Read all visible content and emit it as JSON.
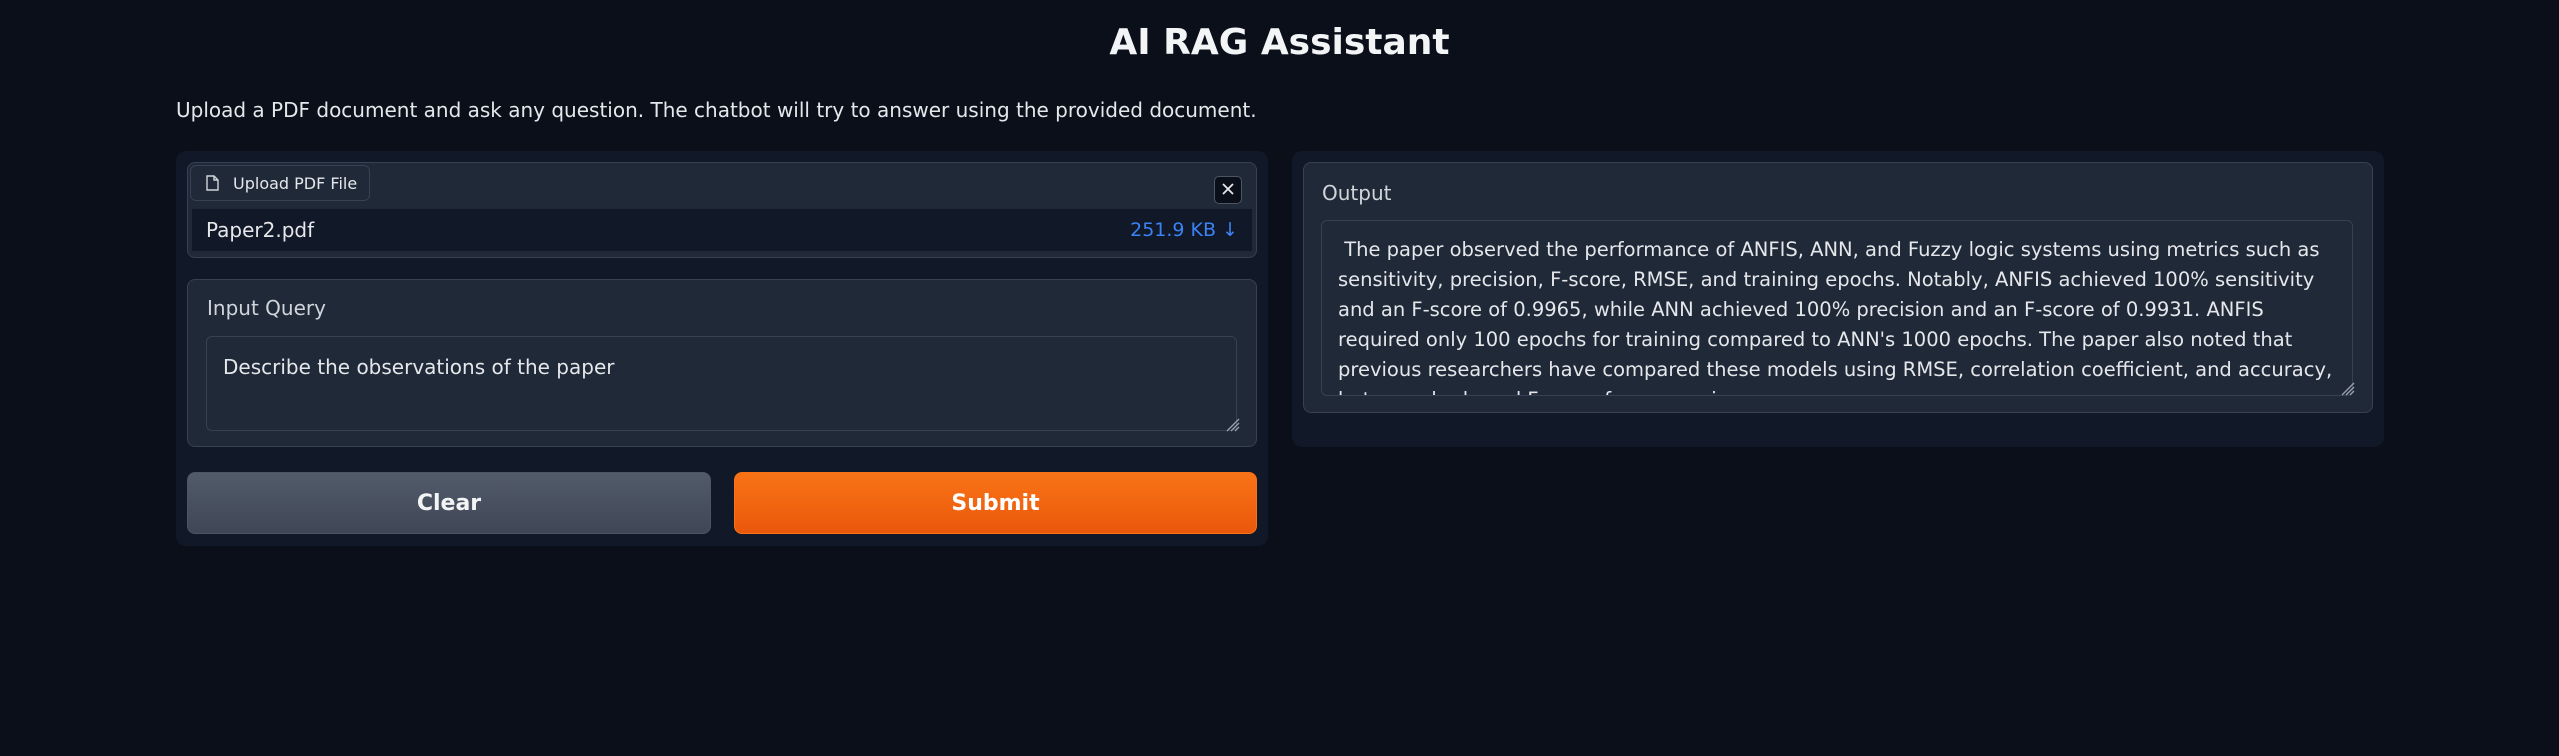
{
  "app": {
    "title": "AI RAG Assistant",
    "description": "Upload a PDF document and ask any question. The chatbot will try to answer using the provided document."
  },
  "upload": {
    "tab_label": "Upload PDF File",
    "file_name": "Paper2.pdf",
    "file_size": "251.9 KB ↓",
    "icons": {
      "file": "file-icon",
      "close": "close-icon"
    }
  },
  "query": {
    "label": "Input Query",
    "value": "Describe the observations of the paper"
  },
  "buttons": {
    "clear_label": "Clear",
    "submit_label": "Submit"
  },
  "output": {
    "label": "Output",
    "text": " The paper observed the performance of ANFIS, ANN, and Fuzzy logic systems using metrics such as sensitivity, precision, F-score, RMSE, and training epochs. Notably, ANFIS achieved 100% sensitivity and an F-score of 0.9965, while ANN achieved 100% precision and an F-score of 0.9931. ANFIS required only 100 epochs for training compared to ANN's 1000 epochs. The paper also noted that previous researchers have compared these models using RMSE, correlation coefficient, and accuracy, but none had used F-score for comparison."
  },
  "colors": {
    "background": "#0b0f19",
    "panel": "#111827",
    "block": "#1f2937",
    "accent": "#f97316",
    "link": "#3b82f6"
  }
}
